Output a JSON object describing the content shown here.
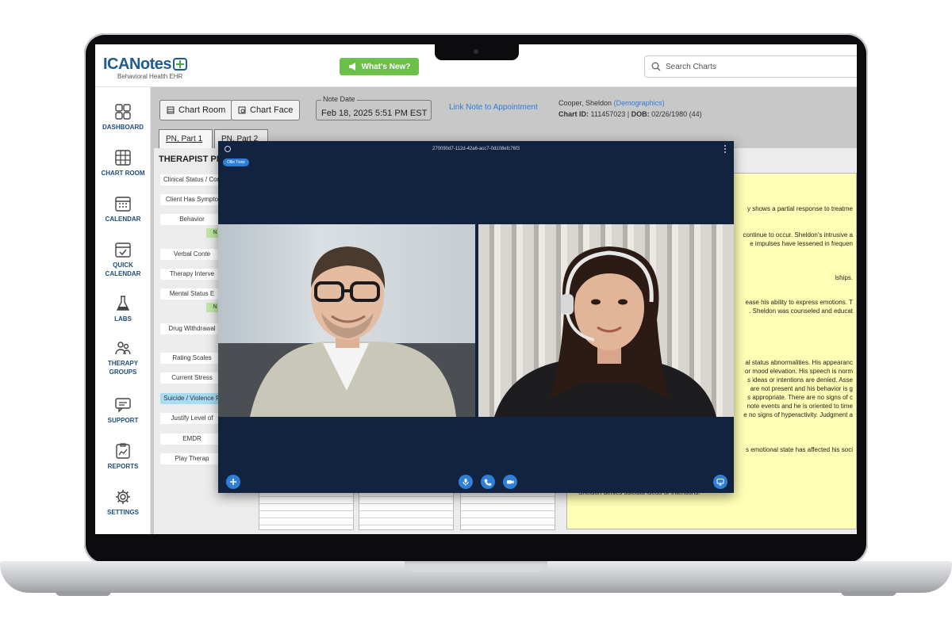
{
  "app": {
    "logo_main": "ICANotes",
    "logo_sub": "Behavioral Health EHR",
    "whats_new": "What's New?",
    "search_placeholder": "Search Charts"
  },
  "sidebar": {
    "items": [
      {
        "label": "DASHBOARD",
        "icon": "dashboard-icon"
      },
      {
        "label": "CHART ROOM",
        "icon": "chart-room-icon"
      },
      {
        "label": "CALENDAR",
        "icon": "calendar-icon"
      },
      {
        "label": "QUICK CALENDAR",
        "icon": "quick-calendar-icon"
      },
      {
        "label": "LABS",
        "icon": "flask-icon"
      },
      {
        "label": "THERAPY GROUPS",
        "icon": "group-icon"
      },
      {
        "label": "SUPPORT",
        "icon": "chat-icon"
      },
      {
        "label": "REPORTS",
        "icon": "report-icon"
      },
      {
        "label": "SETTINGS",
        "icon": "gear-icon"
      }
    ]
  },
  "toolbar": {
    "chart_room": "Chart Room",
    "chart_face": "Chart Face",
    "note_date_label": "Note Date",
    "note_date_value": "Feb 18, 2025 5:51 PM EST",
    "link_appointment": "Link Note to Appointment"
  },
  "patient": {
    "name": "Cooper, Sheldon",
    "demographics": "(Demographics)",
    "chart_id_label": "Chart ID:",
    "chart_id": "111457023",
    "dob_label": "DOB:",
    "dob": "02/26/1980 (44)"
  },
  "tabs": [
    {
      "label": "PN, Part 1"
    },
    {
      "label": "PN, Part 2"
    }
  ],
  "panel": {
    "title": "THERAPIST PN,",
    "sections": [
      "Clinical Status / Con",
      "Client Has Sympto",
      "Behavior",
      "Verbal Conte",
      "Therapy Interve",
      "Mental Status E",
      "Drug Withdrawal",
      "Rating Scales",
      "Current Stress",
      "Suicide / Violence R",
      "Justify Level of",
      "EMDR",
      "Play Therap"
    ],
    "mini_tags": [
      "N",
      "N"
    ]
  },
  "note_text": [
    "y shows a partial response to treatme",
    "continue to occur. Sheldon's intrusive a",
    "e impulses have lessened in frequen",
    "lships.",
    "ease his ability to express emotions. T",
    ". Sheldon was counseled and educat",
    "al status abnormalities. His appearanc",
    "or mood elevation. His speech is norm",
    "s ideas or intentions are denied. Asse",
    "are not present and his behavior is g",
    "s appropriate. There are no signs of c",
    "note events and he is oriented to time",
    "e no signs of hyperactivity. Judgment a",
    "s emotional state has affected his soci",
    "Sheldon denies suicidal ideas or intentions."
  ],
  "video": {
    "session_id": "270090d7-112d-42a6-acc7-0d108efc76f3",
    "participant_badge": "Ollie Twist"
  }
}
